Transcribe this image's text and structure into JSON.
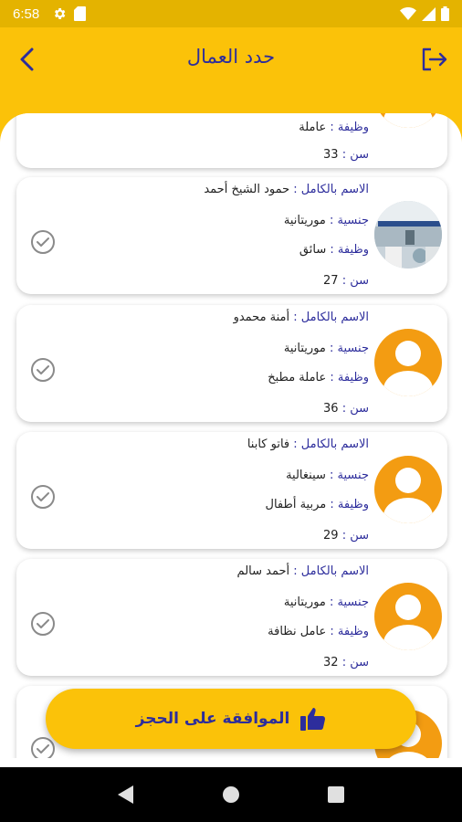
{
  "status_bar": {
    "time": "6:58",
    "icons": [
      "gear-icon",
      "sim-card-icon",
      "wifi-icon",
      "signal-icon",
      "battery-icon"
    ]
  },
  "app_bar": {
    "title": "حدد العمال",
    "back_icon": "chevron-left-icon",
    "logout_icon": "logout-icon"
  },
  "labels": {
    "name": "الاسم بالكامل :",
    "nationality": "جنسية :",
    "job": "وظيفة :",
    "age": "سن :"
  },
  "partial_card": {
    "job_label": "وظيفة :",
    "job": "عاملة",
    "age_label": "سن :",
    "age": "33"
  },
  "workers": [
    {
      "name": "حمود الشيخ أحمد",
      "nationality": "موريتانية",
      "job": "سائق",
      "age": "27",
      "avatar": "photo"
    },
    {
      "name": "أمنة محمدو",
      "nationality": "موريتانية",
      "job": "عاملة مطبخ",
      "age": "36",
      "avatar": "default"
    },
    {
      "name": "فاتو كابنا",
      "nationality": "سينغالية",
      "job": "مربية أطفال",
      "age": "29",
      "avatar": "default"
    },
    {
      "name": "أحمد سالم",
      "nationality": "موريتانية",
      "job": "عامل نظافة",
      "age": "32",
      "avatar": "default"
    }
  ],
  "confirm_button": {
    "label": "الموافقة على الحجز",
    "icon": "thumbs-up-icon"
  },
  "nav": {
    "back_icon": "nav-back-icon",
    "home_icon": "nav-home-icon",
    "recents_icon": "nav-recents-icon"
  },
  "colors": {
    "primary": "#fbc209",
    "status_bar": "#e4b300",
    "accent_text": "#2d2d9c",
    "avatar": "#f39c12"
  }
}
